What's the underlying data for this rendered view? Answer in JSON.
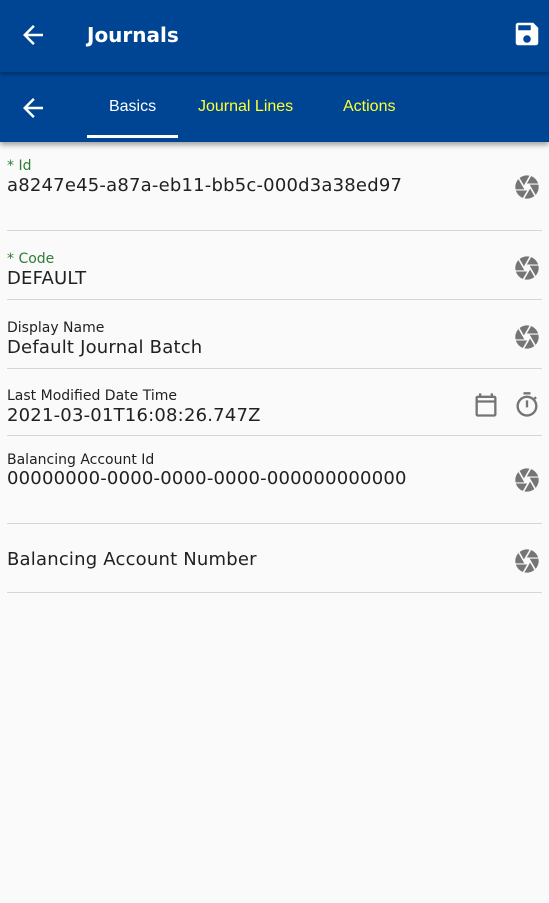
{
  "appbar": {
    "title": "Journals",
    "back_icon": "arrow-left-icon",
    "save_icon": "floppy-save-icon"
  },
  "tabs": {
    "back_icon": "arrow-left-icon",
    "items": [
      {
        "label": "Basics",
        "active": true
      },
      {
        "label": "Journal Lines",
        "active": false
      },
      {
        "label": "Actions",
        "active": false
      }
    ]
  },
  "fields": {
    "id": {
      "label": "* Id",
      "value": "a8247e45-a87a-eb11-bb5c-000d3a38ed97",
      "icon": "aperture-icon"
    },
    "code": {
      "label": "* Code",
      "value": "DEFAULT",
      "icon": "aperture-icon"
    },
    "display_name": {
      "label": "Display Name",
      "value": "Default Journal Batch",
      "icon": "aperture-icon"
    },
    "last_modified": {
      "label": "Last Modified Date Time",
      "value": "2021-03-01T16:08:26.747Z",
      "icons": [
        "calendar-icon",
        "stopwatch-icon"
      ]
    },
    "balancing_account_id": {
      "label": "Balancing Account Id",
      "value": "00000000-0000-0000-0000-000000000000",
      "icon": "aperture-icon"
    },
    "balancing_account_number": {
      "label": "",
      "placeholder": "Balancing Account Number",
      "value": "",
      "icon": "aperture-icon"
    }
  },
  "colors": {
    "bar": "#004594",
    "active_tab": "#ffffff",
    "inactive_tab": "#ffff33",
    "required_label": "#2e7d32",
    "icon": "#757575"
  }
}
